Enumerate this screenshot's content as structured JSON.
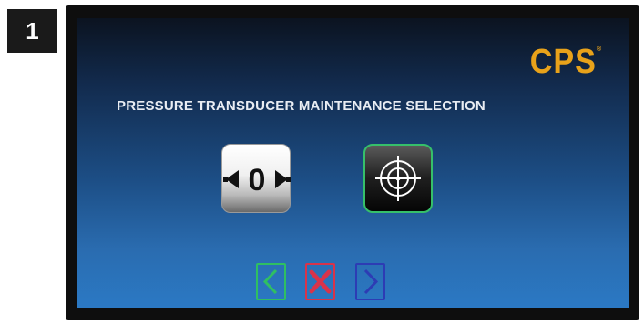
{
  "step_badge": "1",
  "logo": {
    "text": "CPS",
    "mark": "®",
    "color": "#e8a21a"
  },
  "screen": {
    "title": "PRESSURE TRANSDUCER MAINTENANCE SELECTION"
  },
  "options": [
    {
      "name": "zero-icon",
      "label": "0"
    },
    {
      "name": "crosshair-target-icon"
    }
  ],
  "navigation": [
    {
      "name": "back-chevron-icon",
      "color": "#2fbf62"
    },
    {
      "name": "cancel-x-icon",
      "color": "#d9334a"
    },
    {
      "name": "next-chevron-icon",
      "color": "#2d3cb4"
    }
  ]
}
